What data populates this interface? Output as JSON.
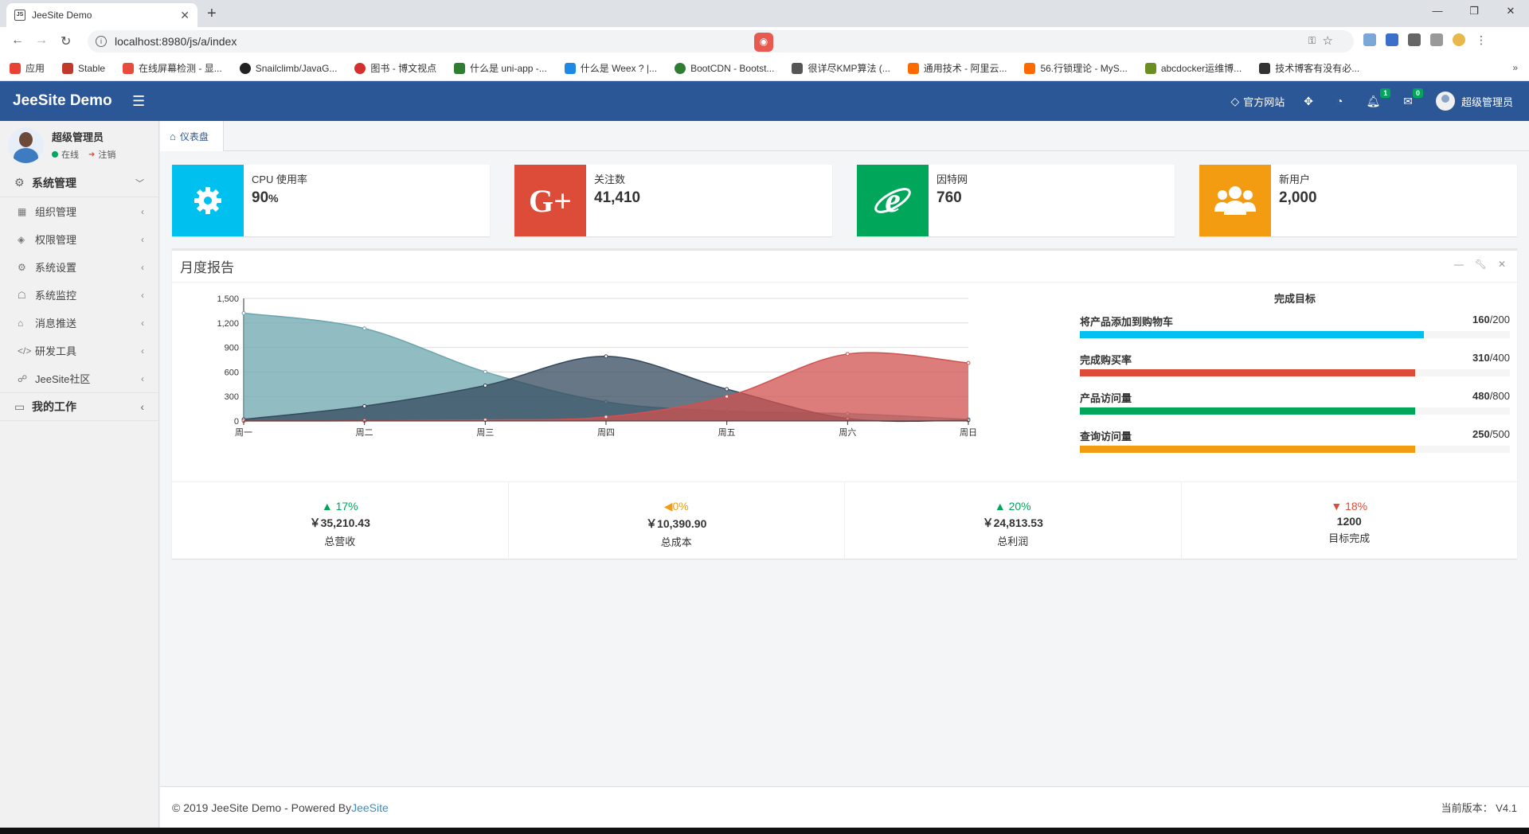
{
  "browser": {
    "tab_title": "JeeSite Demo",
    "tab_favicon": "JS",
    "url": "localhost:8980/js/a/index",
    "bookmarks": [
      {
        "label": "应用",
        "color": "#e94235"
      },
      {
        "label": "Stable",
        "color": "#c0392b"
      },
      {
        "label": "在线屏幕检测 - 显...",
        "color": "#e74c3c"
      },
      {
        "label": "Snailclimb/JavaG...",
        "color": "#222222"
      },
      {
        "label": "图书 - 博文视点",
        "color": "#d32f2f"
      },
      {
        "label": "什么是 uni-app -...",
        "color": "#2e7d32"
      },
      {
        "label": "什么是 Weex ? |...",
        "color": "#1e88e5"
      },
      {
        "label": "BootCDN - Bootst...",
        "color": "#2e7d32"
      },
      {
        "label": "很详尽KMP算法 (...",
        "color": "#555555"
      },
      {
        "label": "通用技术 - 阿里云...",
        "color": "#ff6a00"
      },
      {
        "label": "56.行锁理论 - MyS...",
        "color": "#ff6a00"
      },
      {
        "label": "abcdocker运维博...",
        "color": "#6b8e23"
      },
      {
        "label": "技术博客有没有必...",
        "color": "#333333"
      }
    ]
  },
  "header": {
    "logo": "JeeSite Demo",
    "official_site": "官方网站",
    "notif_count": "1",
    "msg_count": "0",
    "user": "超级管理员"
  },
  "sidebar": {
    "user_name": "超级管理员",
    "status": "在线",
    "logout": "注销",
    "sections": [
      {
        "label": "系统管理"
      },
      {
        "label": "我的工作"
      }
    ],
    "items": [
      {
        "label": "组织管理"
      },
      {
        "label": "权限管理"
      },
      {
        "label": "系统设置"
      },
      {
        "label": "系统监控"
      },
      {
        "label": "消息推送"
      },
      {
        "label": "研发工具"
      },
      {
        "label": "JeeSite社区"
      }
    ]
  },
  "breadcrumb": {
    "home": "仪表盘"
  },
  "info_boxes": [
    {
      "label": "CPU 使用率",
      "value": "90",
      "unit": "%",
      "color": "#00c0ef",
      "icon": "gear-icon"
    },
    {
      "label": "关注数",
      "value": "41,410",
      "unit": "",
      "color": "#dd4b39",
      "icon": "google-plus-icon"
    },
    {
      "label": "因特网",
      "value": "760",
      "unit": "",
      "color": "#00a65a",
      "icon": "internet-explorer-icon"
    },
    {
      "label": "新用户",
      "value": "2,000",
      "unit": "",
      "color": "#f39c12",
      "icon": "users-icon"
    }
  ],
  "report": {
    "title": "月度报告",
    "goals_title": "完成目标",
    "goals": [
      {
        "label": "将产品添加到购物车",
        "done": "160",
        "total": "/200",
        "color": "#00c0ef",
        "fraction": 0.8
      },
      {
        "label": "完成购买率",
        "done": "310",
        "total": "/400",
        "color": "#dd4b39",
        "fraction": 0.78
      },
      {
        "label": "产品访问量",
        "done": "480",
        "total": "/800",
        "color": "#00a65a",
        "fraction": 0.78
      },
      {
        "label": "查询访问量",
        "done": "250",
        "total": "/500",
        "color": "#f39c12",
        "fraction": 0.78
      }
    ],
    "summary": [
      {
        "pct": "17%",
        "dir": "up",
        "color": "#00a65a",
        "amount": "￥35,210.43",
        "label": "总营收"
      },
      {
        "pct": "0%",
        "dir": "left",
        "color": "#f39c12",
        "amount": "￥10,390.90",
        "label": "总成本"
      },
      {
        "pct": "20%",
        "dir": "up",
        "color": "#00a65a",
        "amount": "￥24,813.53",
        "label": "总利润"
      },
      {
        "pct": "18%",
        "dir": "down",
        "color": "#dd4b39",
        "amount": "1200",
        "label": "目标完成"
      }
    ]
  },
  "chart_data": {
    "type": "area",
    "categories": [
      "周一",
      "周二",
      "周三",
      "周四",
      "周五",
      "周六",
      "周日"
    ],
    "ylim": [
      0,
      1500
    ],
    "yticks": [
      "0",
      "300",
      "600",
      "900",
      "1,200",
      "1,500"
    ],
    "grid": true,
    "series": [
      {
        "values": [
          1320,
          1132,
          601,
          234,
          120,
          90,
          20
        ],
        "color": "#6ba5ad"
      },
      {
        "values": [
          20,
          182,
          434,
          791,
          390,
          30,
          10
        ],
        "color": "#34495e"
      },
      {
        "values": [
          1,
          2,
          12,
          50,
          300,
          820,
          710
        ],
        "color": "#d0514f"
      }
    ]
  },
  "footer": {
    "copyright": "© 2019 JeeSite Demo - Powered By ",
    "link": "JeeSite",
    "version": "当前版本：  V4.1"
  }
}
